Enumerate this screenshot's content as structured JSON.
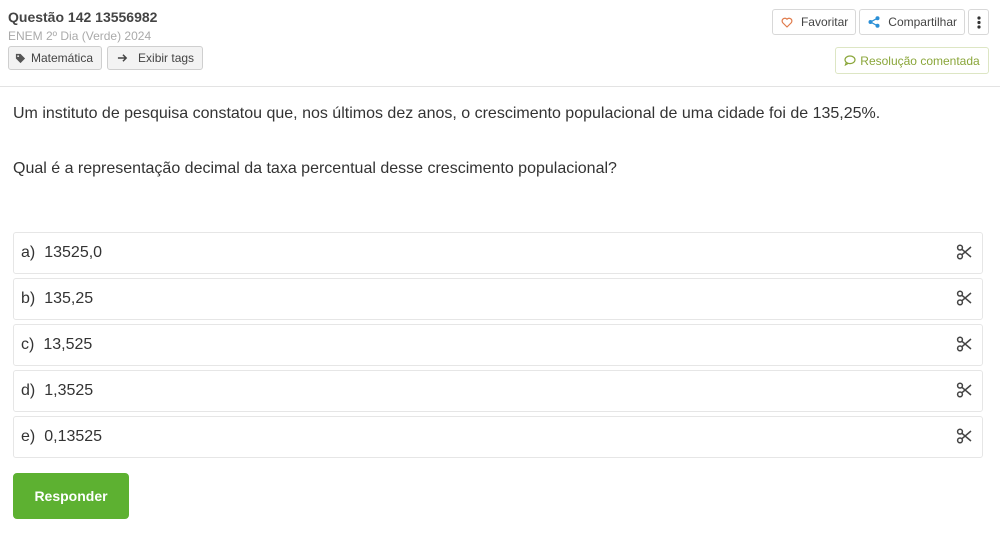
{
  "header": {
    "title": "Questão 142 13556982",
    "subtitle": "ENEM 2º Dia (Verde) 2024",
    "tag_label": "Matemática",
    "show_tags_label": "Exibir tags",
    "favorite_label": "Favoritar",
    "share_label": "Compartilhar",
    "resolution_label": "Resolução comentada"
  },
  "question": {
    "statement": "Um instituto de pesquisa constatou que, nos últimos dez anos, o crescimento populacional de uma cidade foi de 135,25%.",
    "prompt": "Qual é a representação decimal da taxa percentual desse crescimento populacional?"
  },
  "options": [
    {
      "letter": "a)",
      "text": "13525,0"
    },
    {
      "letter": "b)",
      "text": "135,25"
    },
    {
      "letter": "c)",
      "text": "13,525"
    },
    {
      "letter": "d)",
      "text": "1,3525"
    },
    {
      "letter": "e)",
      "text": "0,13525"
    }
  ],
  "actions": {
    "submit_label": "Responder"
  },
  "icons": {
    "tag": "tag-icon",
    "arrow": "arrow-right-icon",
    "favorite": "heart-icon",
    "share": "share-icon",
    "more": "more-vertical-icon",
    "resolution": "comment-icon",
    "eliminate": "scissors-icon"
  },
  "colors": {
    "submit_bg": "#5db131",
    "resolution_text": "#8aa63a",
    "heart": "#e07b4b",
    "share": "#2a8fd6"
  }
}
